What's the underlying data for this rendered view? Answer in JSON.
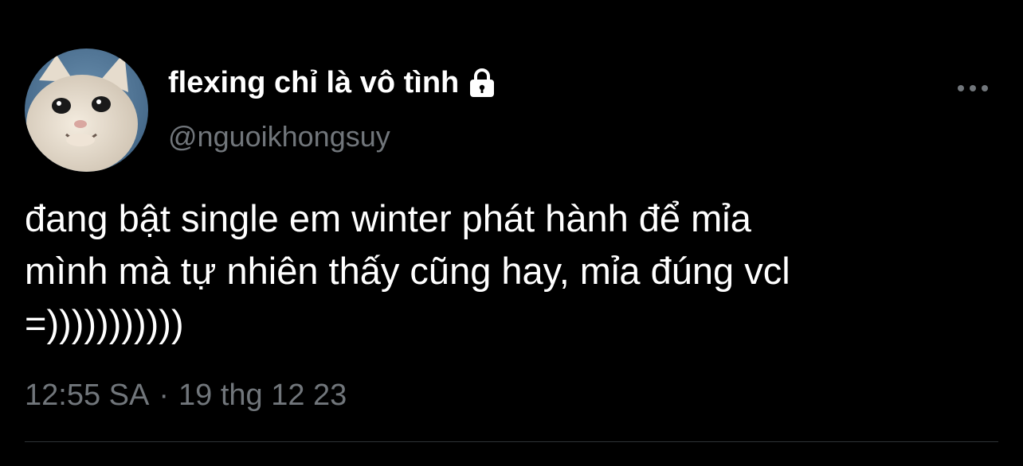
{
  "tweet": {
    "author": {
      "display_name": "flexing chỉ là vô tình",
      "handle": "@nguoikhongsuy",
      "protected_icon": "lock-icon",
      "avatar": "cat-avatar"
    },
    "text_lines": [
      "đang bật single em winter phát hành để mỉa",
      "mình mà tự nhiên thấy cũng hay, mỉa đúng vcl",
      "=)))))))))))"
    ],
    "time": "12:55 SA",
    "separator": "·",
    "date": "19 thg 12 23",
    "more_icon": "more-horizontal-icon"
  },
  "colors": {
    "background": "#000000",
    "primary_text": "#ffffff",
    "secondary_text": "#71767b",
    "divider": "#2f3336"
  }
}
